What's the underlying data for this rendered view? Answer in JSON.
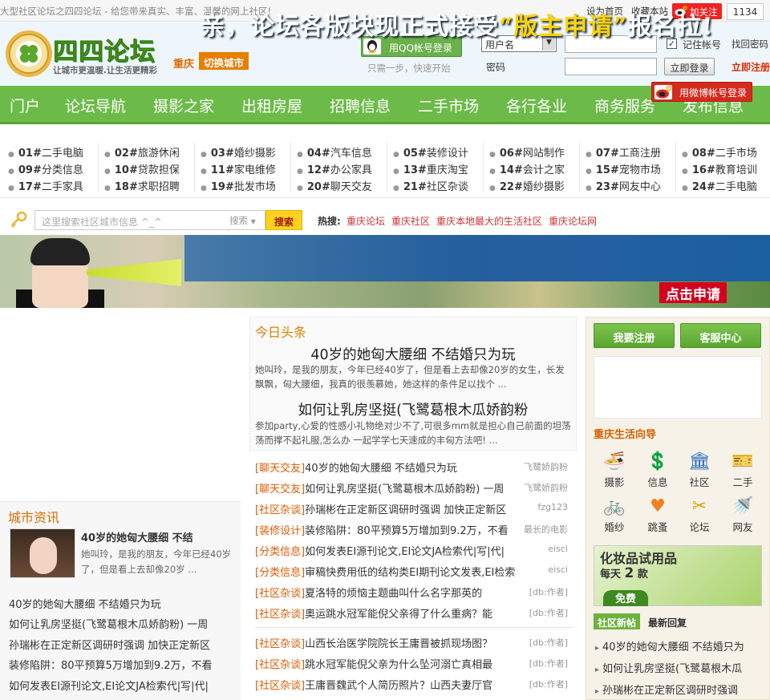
{
  "topbar": {
    "slogan": "大型社区论坛之四四论坛 - 给您带来真实、丰富、温馨的网上社区!",
    "set_home": "设为首页",
    "bookmark": "收藏本站",
    "follow": "加关注",
    "follow_count": "1134"
  },
  "header": {
    "logo_text": "四四论坛",
    "logo_sub": "让城市更温暖.让生活更精彩",
    "city": "重庆",
    "switch_city": "切换城市"
  },
  "login": {
    "qq_login": "用QQ帐号登录",
    "qq_hint": "只需一步，快速开始",
    "user_select": "用户名",
    "password_label": "密码",
    "remember": "记住帐号",
    "remember_checked": "✓",
    "login_button": "立即登录",
    "forgot": "找回密码",
    "register": "立即注册",
    "weibo_login": "用微博帐号登录"
  },
  "nav": [
    "门户",
    "论坛导航",
    "摄影之家",
    "出租房屋",
    "招聘信息",
    "二手市场",
    "各行各业",
    "商务服务",
    "发布信息"
  ],
  "categories": [
    [
      {
        "no": "01#",
        "name": "二手电脑"
      },
      {
        "no": "09#",
        "name": "分类信息"
      },
      {
        "no": "17#",
        "name": "二手家具"
      }
    ],
    [
      {
        "no": "02#",
        "name": "旅游休闲"
      },
      {
        "no": "10#",
        "name": "贷款担保"
      },
      {
        "no": "18#",
        "name": "求职招聘"
      }
    ],
    [
      {
        "no": "03#",
        "name": "婚纱摄影"
      },
      {
        "no": "11#",
        "name": "家电维修"
      },
      {
        "no": "19#",
        "name": "批发市场"
      }
    ],
    [
      {
        "no": "04#",
        "name": "汽车信息"
      },
      {
        "no": "12#",
        "name": "办公家具"
      },
      {
        "no": "20#",
        "name": "聊天交友"
      }
    ],
    [
      {
        "no": "05#",
        "name": "装修设计"
      },
      {
        "no": "13#",
        "name": "重庆淘宝"
      },
      {
        "no": "21#",
        "name": "社区杂谈"
      }
    ],
    [
      {
        "no": "06#",
        "name": "网站制作"
      },
      {
        "no": "14#",
        "name": "会计之家"
      },
      {
        "no": "22#",
        "name": "婚纱摄影"
      }
    ],
    [
      {
        "no": "07#",
        "name": "工商注册"
      },
      {
        "no": "15#",
        "name": "宠物市场"
      },
      {
        "no": "23#",
        "name": "网友中心"
      }
    ],
    [
      {
        "no": "08#",
        "name": "二手市场"
      },
      {
        "no": "16#",
        "name": "教育培训"
      },
      {
        "no": "24#",
        "name": "二手电脑"
      }
    ]
  ],
  "search": {
    "placeholder": "这里搜索社区城市信息 ^_^",
    "type": "搜索",
    "button": "搜索",
    "hot_label": "热搜:",
    "hot": [
      "重庆论坛",
      "重庆社区",
      "重庆本地最大的生活社区",
      "重庆论坛网"
    ]
  },
  "banner": {
    "text_a": "亲，论坛各版块现正式接受",
    "text_b": "“版主申请”",
    "text_c": "报名拉!",
    "cta": "点击申请"
  },
  "today": {
    "title": "今日头条",
    "items": [
      {
        "title": "40岁的她匈大腰细  不结婚只为玩",
        "desc": "她叫玲，是我的朋友，今年已经40岁了，但是看上去却像20岁的女生，长发飘飘，匈大腰细，我真的很羡慕她，她这样的条件足以找个 ..."
      },
      {
        "title": "如何让乳房坚挺(飞鹭葛根木瓜娇韵粉",
        "desc": "参加party,心爱的性感小礼物绝对少不了,可很多mm就是担心自己前面的坦荡荡而撑不起礼服,怎么办 一起学学七天速成的丰匈方法吧! ..."
      }
    ]
  },
  "news": [
    {
      "tag": "[聊天交友]",
      "title": "40岁的她匈大腰细 不结婚只为玩",
      "src": "飞鹭娇韵粉"
    },
    {
      "tag": "[聊天交友]",
      "title": "如何让乳房坚挺(飞鹭葛根木瓜娇韵粉) 一周",
      "src": "飞鹭娇韵粉"
    },
    {
      "tag": "[社区杂谈]",
      "title": "孙瑞彬在正定新区调研时强调 加快正定新区",
      "src": "fzg123"
    },
    {
      "tag": "[装修设计]",
      "title": "装修陷阱：80平预算5万增加到9.2万，不看",
      "src": "最长的电影"
    },
    {
      "tag": "[分类信息]",
      "title": "如何发表EI源刊论文,EI论文JA检索代|写|代|",
      "src": "eisci"
    },
    {
      "tag": "[分类信息]",
      "title": "审稿快费用低的结构类EI期刊论文发表,EI检索",
      "src": "eisci"
    },
    {
      "tag": "[社区杂谈]",
      "title": "夏洛特的烦恼主题曲叫什么名字那英的",
      "src": "[db:作者]"
    },
    {
      "tag": "[社区杂谈]",
      "title": "奥运跳水冠军能倪父亲得了什么重病？能",
      "src": "[db:作者]"
    },
    {
      "tag": "[社区杂谈]",
      "title": "山西长治医学院院长王庸晋被抓现场图？",
      "src": "[db:作者]"
    },
    {
      "tag": "[社区杂谈]",
      "title": "跳水冠军能倪父亲为什么坠河溺亡真相最",
      "src": "[db:作者]"
    },
    {
      "tag": "[社区杂谈]",
      "title": "王庸晋魏武个人简历照片？山西夫妻厅官",
      "src": "[db:作者]"
    }
  ],
  "city_news": {
    "title": "城市资讯",
    "headline": "40岁的她匈大腰细 不结",
    "desc": "她叫玲，是我的朋友，今年已经40岁了，但是看上去却像20岁 ...",
    "items": [
      "40岁的她匈大腰细 不结婚只为玩",
      "如何让乳房坚挺(飞鹭葛根木瓜娇韵粉) 一周",
      "孙瑞彬在正定新区调研时强调 加快正定新区",
      "装修陷阱：80平预算5万增加到9.2万，不看",
      "如何发表EI源刊论文,EI论文JA检索代|写|代|"
    ]
  },
  "right": {
    "register": "我要注册",
    "service": "客服中心",
    "guide_title": "重庆生活向导",
    "guide": [
      {
        "label": "摄影",
        "icon": "camera-icon",
        "glyph": "🍜",
        "color": "#3a8a30"
      },
      {
        "label": "信息",
        "icon": "money-icon",
        "glyph": "💲",
        "color": "#d03030"
      },
      {
        "label": "社区",
        "icon": "building-icon",
        "glyph": "🏛",
        "color": "#3070c0"
      },
      {
        "label": "二手",
        "icon": "ticket-icon",
        "glyph": "🎫",
        "color": "#e0a000"
      },
      {
        "label": "婚纱",
        "icon": "bicycle-icon",
        "glyph": "🚲",
        "color": "#e07000"
      },
      {
        "label": "跳蚤",
        "icon": "heart-icon",
        "glyph": "♥",
        "color": "#f08020"
      },
      {
        "label": "论坛",
        "icon": "scissors-icon",
        "glyph": "✂",
        "color": "#e0a000"
      },
      {
        "label": "网友",
        "icon": "shower-icon",
        "glyph": "🚿",
        "color": "#3090c0"
      }
    ],
    "ad_title": "化妆品试用品",
    "ad_sub_a": "每天",
    "ad_sub_num": "2",
    "ad_sub_b": "款",
    "ad_free": "免费",
    "tab_new": "社区新帖",
    "tab_reply": "最新回复",
    "items": [
      "40岁的她匈大腰细 不结婚只为",
      "如何让乳房坚挺(飞鹭葛根木瓜",
      "孙瑞彬在正定新区调研时强调"
    ]
  }
}
